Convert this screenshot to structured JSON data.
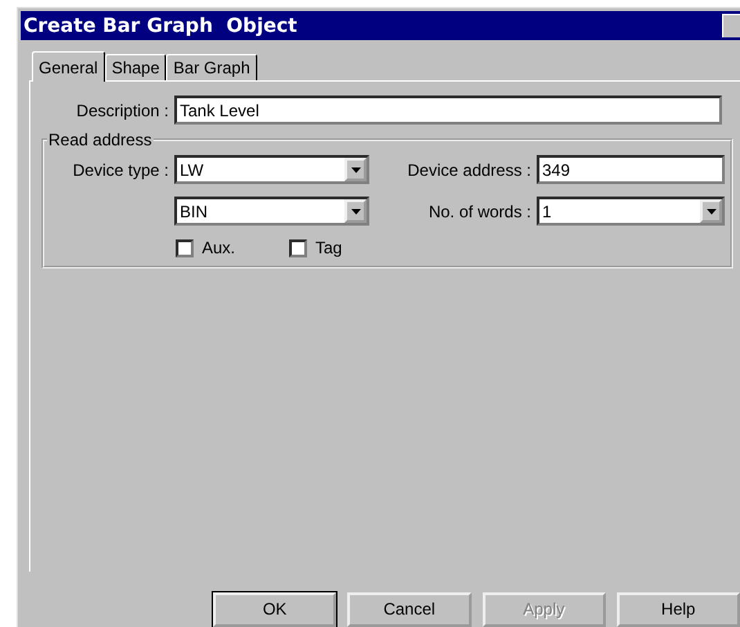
{
  "window": {
    "title": "Create Bar Graph  Object"
  },
  "tabs": [
    {
      "label": "General",
      "selected": true
    },
    {
      "label": "Shape",
      "selected": false
    },
    {
      "label": "Bar Graph",
      "selected": false
    }
  ],
  "description": {
    "label": "Description :",
    "value": "Tank Level"
  },
  "read_address": {
    "title": "Read address",
    "device_type": {
      "label": "Device type :",
      "value": "LW"
    },
    "format": {
      "value": "BIN"
    },
    "device_address": {
      "label": "Device address :",
      "value": "349"
    },
    "no_of_words": {
      "label": "No. of words :",
      "value": "1"
    },
    "checkboxes": [
      {
        "label": "Aux.",
        "checked": false
      },
      {
        "label": "Tag",
        "checked": false
      }
    ]
  },
  "buttons": [
    {
      "label": "OK",
      "default": true,
      "disabled": false
    },
    {
      "label": "Cancel",
      "default": false,
      "disabled": false
    },
    {
      "label": "Apply",
      "default": false,
      "disabled": true
    },
    {
      "label": "Help",
      "default": false,
      "disabled": false
    }
  ]
}
